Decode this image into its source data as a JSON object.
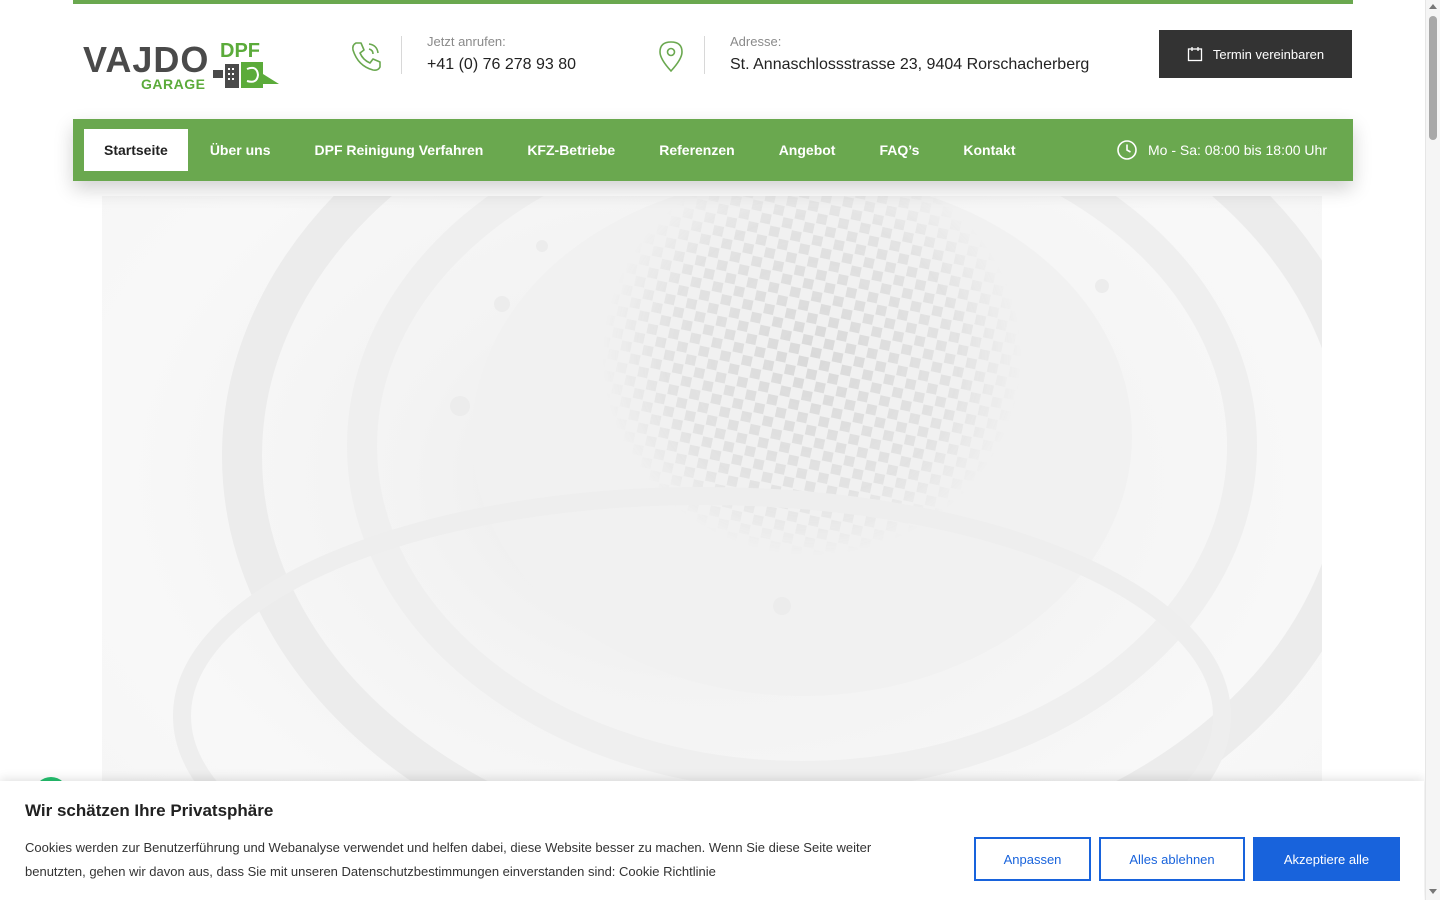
{
  "logo": {
    "main": "VAJDO",
    "sub": "GARAGE",
    "badge": "DPF"
  },
  "contact": {
    "phone_label": "Jetzt anrufen:",
    "phone_value": "+41 (0) 76 278 93 80",
    "address_label": "Adresse:",
    "address_value": "St. Annaschlossstrasse 23, 9404 Rorschacherberg"
  },
  "cta": {
    "label": "Termin vereinbaren"
  },
  "nav": {
    "items": [
      {
        "label": "Startseite"
      },
      {
        "label": "Über uns"
      },
      {
        "label": "DPF Reinigung Verfahren"
      },
      {
        "label": "KFZ-Betriebe"
      },
      {
        "label": "Referenzen"
      },
      {
        "label": "Angebot"
      },
      {
        "label": "FAQ’s"
      },
      {
        "label": "Kontakt"
      }
    ],
    "opening_hours": "Mo - Sa: 08:00 bis 18:00 Uhr"
  },
  "cookie": {
    "title": "Wir schätzen Ihre Privatsphäre",
    "text": "Cookies werden zur Benutzerführung und Webanalyse verwendet und helfen dabei, diese Website besser zu machen. Wenn Sie diese Seite weiter benutzten, gehen wir davon aus, dass Sie mit unseren Datenschutzbestimmungen einverstanden sind: Cookie Richtlinie",
    "customize_label": "Anpassen",
    "reject_label": "Alles ablehnen",
    "accept_label": "Akzeptiere alle"
  },
  "colors": {
    "brand_green": "#6aa84f",
    "dark_button": "#333333",
    "cookie_blue": "#1863dc"
  },
  "icons": {
    "phone": "phone-icon",
    "address": "map-pin-icon",
    "calendar": "calendar-icon",
    "clock": "clock-icon",
    "chat": "chat-icon"
  }
}
